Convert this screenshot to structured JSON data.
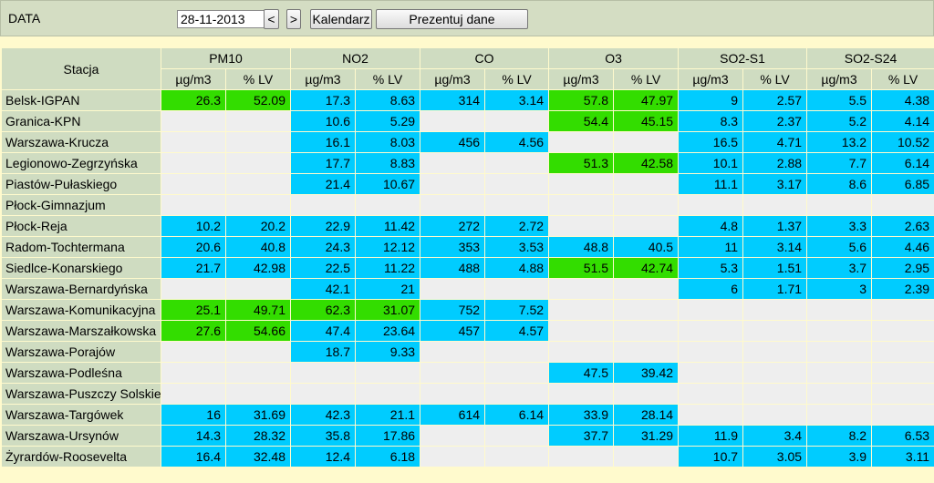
{
  "toolbar": {
    "date_label": "DATA",
    "date_value": "28-11-2013",
    "prev_label": "<",
    "next_label": ">",
    "calendar_label": "Kalendarz",
    "show_label": "Prezentuj dane"
  },
  "table": {
    "station_header": "Stacja",
    "groups": [
      "PM10",
      "NO2",
      "CO",
      "O3",
      "SO2-S1",
      "SO2-S24"
    ],
    "sub_headers": [
      "µg/m3",
      "% LV"
    ],
    "colors": {
      "blue": "#00ccff",
      "green": "#33dd00",
      "empty": "#eeeeee"
    },
    "rows": [
      {
        "station": "Belsk-IGPAN",
        "values": [
          [
            "26.3",
            "52.09",
            "g"
          ],
          [
            "17.3",
            "8.63",
            "b"
          ],
          [
            "314",
            "3.14",
            "b"
          ],
          [
            "57.8",
            "47.97",
            "g"
          ],
          [
            "9",
            "2.57",
            "b"
          ],
          [
            "5.5",
            "4.38",
            "b"
          ]
        ]
      },
      {
        "station": "Granica-KPN",
        "values": [
          [
            "",
            "",
            "e"
          ],
          [
            "10.6",
            "5.29",
            "b"
          ],
          [
            "",
            "",
            "e"
          ],
          [
            "54.4",
            "45.15",
            "g"
          ],
          [
            "8.3",
            "2.37",
            "b"
          ],
          [
            "5.2",
            "4.14",
            "b"
          ]
        ]
      },
      {
        "station": "Warszawa-Krucza",
        "values": [
          [
            "",
            "",
            "e"
          ],
          [
            "16.1",
            "8.03",
            "b"
          ],
          [
            "456",
            "4.56",
            "b"
          ],
          [
            "",
            "",
            "e"
          ],
          [
            "16.5",
            "4.71",
            "b"
          ],
          [
            "13.2",
            "10.52",
            "b"
          ]
        ]
      },
      {
        "station": "Legionowo-Zegrzyńska",
        "values": [
          [
            "",
            "",
            "e"
          ],
          [
            "17.7",
            "8.83",
            "b"
          ],
          [
            "",
            "",
            "e"
          ],
          [
            "51.3",
            "42.58",
            "g"
          ],
          [
            "10.1",
            "2.88",
            "b"
          ],
          [
            "7.7",
            "6.14",
            "b"
          ]
        ]
      },
      {
        "station": "Piastów-Pułaskiego",
        "values": [
          [
            "",
            "",
            "e"
          ],
          [
            "21.4",
            "10.67",
            "b"
          ],
          [
            "",
            "",
            "e"
          ],
          [
            "",
            "",
            "e"
          ],
          [
            "11.1",
            "3.17",
            "b"
          ],
          [
            "8.6",
            "6.85",
            "b"
          ]
        ]
      },
      {
        "station": "Płock-Gimnazjum",
        "values": [
          [
            "",
            "",
            "e"
          ],
          [
            "",
            "",
            "e"
          ],
          [
            "",
            "",
            "e"
          ],
          [
            "",
            "",
            "e"
          ],
          [
            "",
            "",
            "e"
          ],
          [
            "",
            "",
            "e"
          ]
        ]
      },
      {
        "station": "Płock-Reja",
        "values": [
          [
            "10.2",
            "20.2",
            "b"
          ],
          [
            "22.9",
            "11.42",
            "b"
          ],
          [
            "272",
            "2.72",
            "b"
          ],
          [
            "",
            "",
            "e"
          ],
          [
            "4.8",
            "1.37",
            "b"
          ],
          [
            "3.3",
            "2.63",
            "b"
          ]
        ]
      },
      {
        "station": "Radom-Tochtermana",
        "values": [
          [
            "20.6",
            "40.8",
            "b"
          ],
          [
            "24.3",
            "12.12",
            "b"
          ],
          [
            "353",
            "3.53",
            "b"
          ],
          [
            "48.8",
            "40.5",
            "b"
          ],
          [
            "11",
            "3.14",
            "b"
          ],
          [
            "5.6",
            "4.46",
            "b"
          ]
        ]
      },
      {
        "station": "Siedlce-Konarskiego",
        "values": [
          [
            "21.7",
            "42.98",
            "b"
          ],
          [
            "22.5",
            "11.22",
            "b"
          ],
          [
            "488",
            "4.88",
            "b"
          ],
          [
            "51.5",
            "42.74",
            "g"
          ],
          [
            "5.3",
            "1.51",
            "b"
          ],
          [
            "3.7",
            "2.95",
            "b"
          ]
        ]
      },
      {
        "station": "Warszawa-Bernardyńska",
        "values": [
          [
            "",
            "",
            "e"
          ],
          [
            "42.1",
            "21",
            "b"
          ],
          [
            "",
            "",
            "e"
          ],
          [
            "",
            "",
            "e"
          ],
          [
            "6",
            "1.71",
            "b"
          ],
          [
            "3",
            "2.39",
            "b"
          ]
        ]
      },
      {
        "station": "Warszawa-Komunikacyjna",
        "values": [
          [
            "25.1",
            "49.71",
            "g"
          ],
          [
            "62.3",
            "31.07",
            "g"
          ],
          [
            "752",
            "7.52",
            "b"
          ],
          [
            "",
            "",
            "e"
          ],
          [
            "",
            "",
            "e"
          ],
          [
            "",
            "",
            "e"
          ]
        ]
      },
      {
        "station": "Warszawa-Marszałkowska",
        "values": [
          [
            "27.6",
            "54.66",
            "g"
          ],
          [
            "47.4",
            "23.64",
            "b"
          ],
          [
            "457",
            "4.57",
            "b"
          ],
          [
            "",
            "",
            "e"
          ],
          [
            "",
            "",
            "e"
          ],
          [
            "",
            "",
            "e"
          ]
        ]
      },
      {
        "station": "Warszawa-Porajów",
        "values": [
          [
            "",
            "",
            "e"
          ],
          [
            "18.7",
            "9.33",
            "b"
          ],
          [
            "",
            "",
            "e"
          ],
          [
            "",
            "",
            "e"
          ],
          [
            "",
            "",
            "e"
          ],
          [
            "",
            "",
            "e"
          ]
        ]
      },
      {
        "station": "Warszawa-Podleśna",
        "values": [
          [
            "",
            "",
            "e"
          ],
          [
            "",
            "",
            "e"
          ],
          [
            "",
            "",
            "e"
          ],
          [
            "47.5",
            "39.42",
            "b"
          ],
          [
            "",
            "",
            "e"
          ],
          [
            "",
            "",
            "e"
          ]
        ]
      },
      {
        "station": "Warszawa-Puszczy Solskiej",
        "values": [
          [
            "",
            "",
            "e"
          ],
          [
            "",
            "",
            "e"
          ],
          [
            "",
            "",
            "e"
          ],
          [
            "",
            "",
            "e"
          ],
          [
            "",
            "",
            "e"
          ],
          [
            "",
            "",
            "e"
          ]
        ]
      },
      {
        "station": "Warszawa-Targówek",
        "values": [
          [
            "16",
            "31.69",
            "b"
          ],
          [
            "42.3",
            "21.1",
            "b"
          ],
          [
            "614",
            "6.14",
            "b"
          ],
          [
            "33.9",
            "28.14",
            "b"
          ],
          [
            "",
            "",
            "e"
          ],
          [
            "",
            "",
            "e"
          ]
        ]
      },
      {
        "station": "Warszawa-Ursynów",
        "values": [
          [
            "14.3",
            "28.32",
            "b"
          ],
          [
            "35.8",
            "17.86",
            "b"
          ],
          [
            "",
            "",
            "e"
          ],
          [
            "37.7",
            "31.29",
            "b"
          ],
          [
            "11.9",
            "3.4",
            "b"
          ],
          [
            "8.2",
            "6.53",
            "b"
          ]
        ]
      },
      {
        "station": "Żyrardów-Roosevelta",
        "values": [
          [
            "16.4",
            "32.48",
            "b"
          ],
          [
            "12.4",
            "6.18",
            "b"
          ],
          [
            "",
            "",
            "e"
          ],
          [
            "",
            "",
            "e"
          ],
          [
            "10.7",
            "3.05",
            "b"
          ],
          [
            "3.9",
            "3.11",
            "b"
          ]
        ]
      }
    ]
  }
}
